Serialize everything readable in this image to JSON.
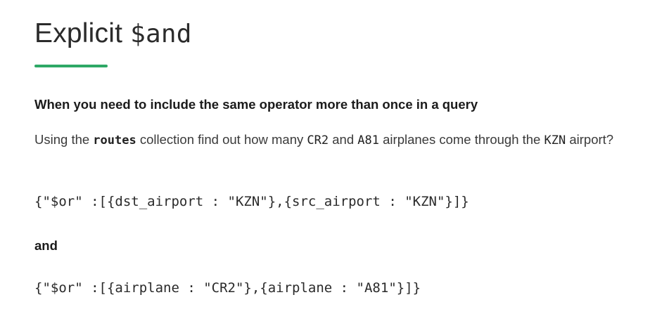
{
  "header": {
    "title_text": "Explicit ",
    "title_code": "$and"
  },
  "accent_color": "#2ea866",
  "content": {
    "lead": "When you need to include the same operator more than once in a query",
    "paragraph": {
      "part1": "Using the ",
      "collection": "routes",
      "part2": " collection find out how many ",
      "airplane1": "CR2",
      "part3": " and ",
      "airplane2": "A81",
      "part4": " airplanes come through the ",
      "airport": "KZN",
      "part5": " airport?"
    },
    "code_query_1": "{\"$or\" :[{dst_airport : \"KZN\"},{src_airport : \"KZN\"}]}",
    "and_label": "and",
    "code_query_2": "{\"$or\" :[{airplane : \"CR2\"},{airplane : \"A81\"}]}"
  }
}
